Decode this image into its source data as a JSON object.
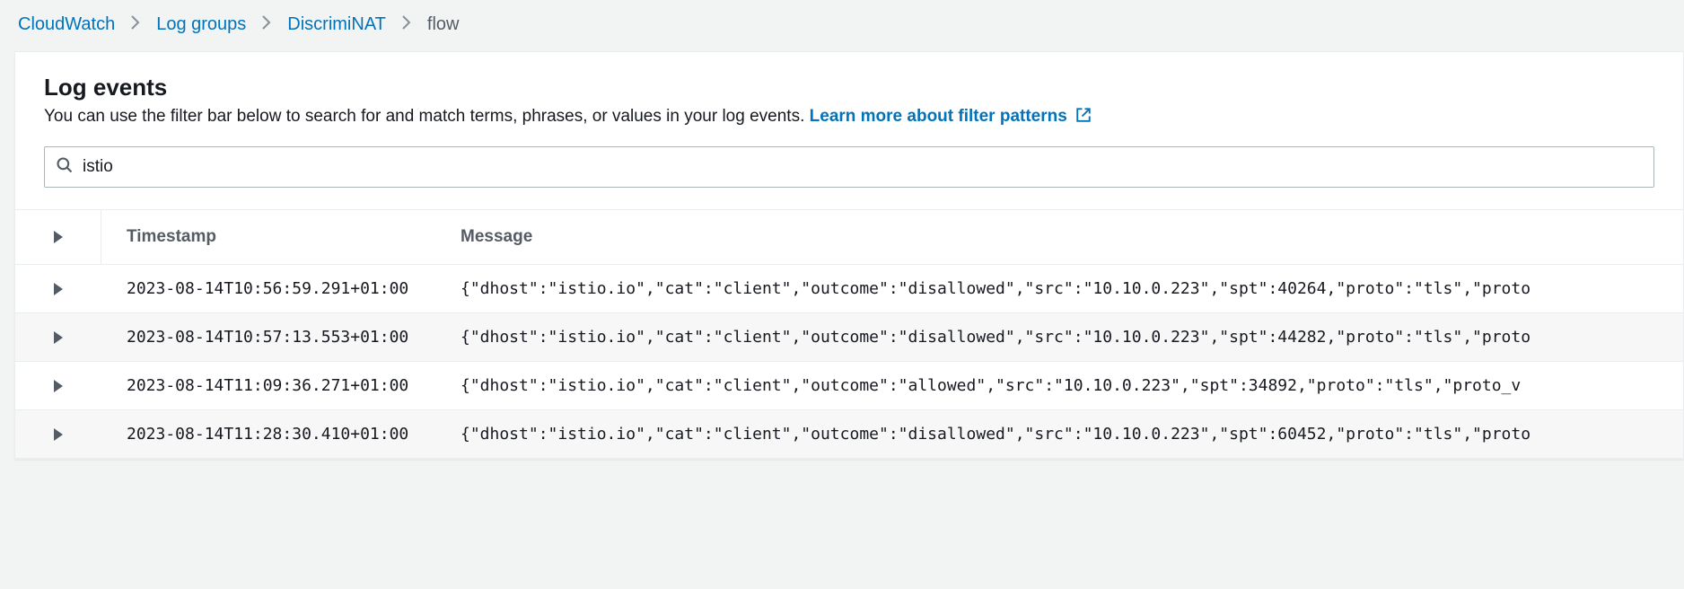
{
  "breadcrumb": {
    "items": [
      {
        "label": "CloudWatch",
        "link": true
      },
      {
        "label": "Log groups",
        "link": true
      },
      {
        "label": "DiscrimiNAT",
        "link": true
      },
      {
        "label": "flow",
        "link": false
      }
    ]
  },
  "header": {
    "title": "Log events",
    "subtitle": "You can use the filter bar below to search for and match terms, phrases, or values in your log events. ",
    "learn_more": "Learn more about filter patterns"
  },
  "search": {
    "value": "istio"
  },
  "table": {
    "columns": {
      "timestamp": "Timestamp",
      "message": "Message"
    },
    "rows": [
      {
        "timestamp": "2023-08-14T10:56:59.291+01:00",
        "message": "{\"dhost\":\"istio.io\",\"cat\":\"client\",\"outcome\":\"disallowed\",\"src\":\"10.10.0.223\",\"spt\":40264,\"proto\":\"tls\",\"proto"
      },
      {
        "timestamp": "2023-08-14T10:57:13.553+01:00",
        "message": "{\"dhost\":\"istio.io\",\"cat\":\"client\",\"outcome\":\"disallowed\",\"src\":\"10.10.0.223\",\"spt\":44282,\"proto\":\"tls\",\"proto"
      },
      {
        "timestamp": "2023-08-14T11:09:36.271+01:00",
        "message": "{\"dhost\":\"istio.io\",\"cat\":\"client\",\"outcome\":\"allowed\",\"src\":\"10.10.0.223\",\"spt\":34892,\"proto\":\"tls\",\"proto_v"
      },
      {
        "timestamp": "2023-08-14T11:28:30.410+01:00",
        "message": "{\"dhost\":\"istio.io\",\"cat\":\"client\",\"outcome\":\"disallowed\",\"src\":\"10.10.0.223\",\"spt\":60452,\"proto\":\"tls\",\"proto"
      }
    ]
  }
}
